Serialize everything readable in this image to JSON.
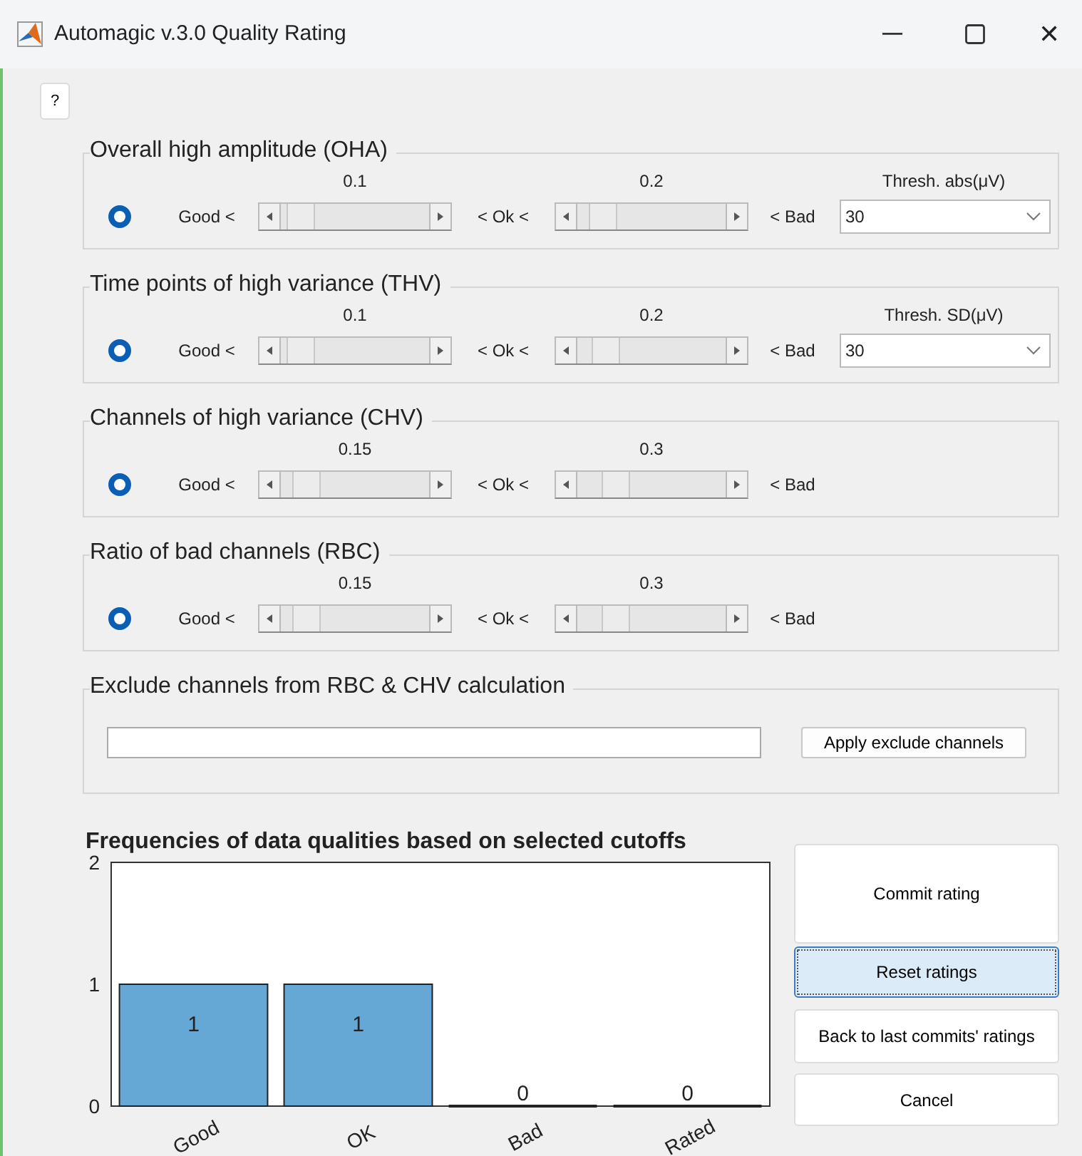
{
  "window": {
    "title": "Automagic v.3.0 Quality Rating",
    "close": "✕"
  },
  "help_button": "?",
  "criteria": [
    {
      "title": "Overall high amplitude (OHA)",
      "selected": true,
      "good_label": "Good <",
      "ok_label": "< Ok <",
      "bad_label": "< Bad",
      "sliders": [
        {
          "value": "0.1",
          "level": 0.05
        },
        {
          "value": "0.2",
          "level": 0.1
        }
      ],
      "threshold": {
        "label": "Thresh. abs(μV)",
        "value": "30"
      }
    },
    {
      "title": "Time points of high variance (THV)",
      "selected": true,
      "good_label": "Good <",
      "ok_label": "< Ok <",
      "bad_label": "< Bad",
      "sliders": [
        {
          "value": "0.1",
          "level": 0.05
        },
        {
          "value": "0.2",
          "level": 0.12
        }
      ],
      "threshold": {
        "label": "Thresh. SD(μV)",
        "value": "30"
      }
    },
    {
      "title": "Channels of high variance (CHV)",
      "selected": true,
      "good_label": "Good <",
      "ok_label": "< Ok <",
      "bad_label": "< Bad",
      "sliders": [
        {
          "value": "0.15",
          "level": 0.1
        },
        {
          "value": "0.3",
          "level": 0.2
        }
      ]
    },
    {
      "title": "Ratio of bad channels (RBC)",
      "selected": true,
      "good_label": "Good <",
      "ok_label": "< Ok <",
      "bad_label": "< Bad",
      "sliders": [
        {
          "value": "0.15",
          "level": 0.1
        },
        {
          "value": "0.3",
          "level": 0.2
        }
      ]
    }
  ],
  "exclude": {
    "title": "Exclude channels from RBC & CHV calculation",
    "button": "Apply exclude channels"
  },
  "chart": {
    "chart_data": {
      "type": "bar",
      "title": "Frequencies of data qualities based on selected cutoffs",
      "categories": [
        "Good",
        "OK",
        "Bad",
        "Rated"
      ],
      "values": [
        1,
        1,
        0,
        0
      ],
      "ylim": [
        0,
        2
      ],
      "yticks": [
        0,
        1,
        2
      ],
      "data_labels": true
    }
  },
  "buttons": [
    {
      "label": "Commit rating",
      "focused": false
    },
    {
      "label": "Reset ratings",
      "focused": true
    },
    {
      "label": "Back to last commits' ratings",
      "focused": false
    },
    {
      "label": "Cancel",
      "focused": false
    }
  ]
}
